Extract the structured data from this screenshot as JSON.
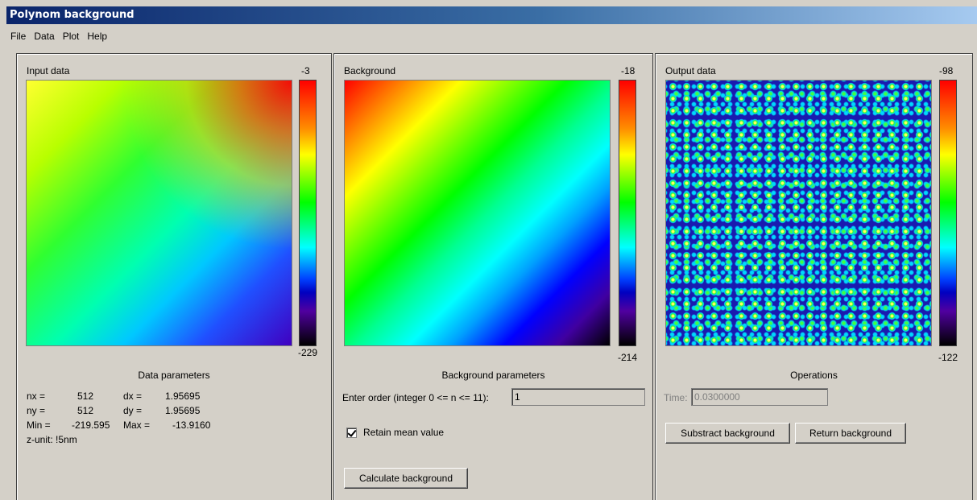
{
  "window": {
    "title": "Polynom background"
  },
  "menu": [
    "File",
    "Data",
    "Plot",
    "Help"
  ],
  "input_panel": {
    "title": "Input data",
    "scale_max": "-3",
    "scale_min": "-229",
    "params_title": "Data parameters",
    "nx_label": "nx =",
    "nx": "512",
    "dx_label": "dx =",
    "dx": "1.95695",
    "ny_label": "ny =",
    "ny": "512",
    "dy_label": "dy =",
    "dy": "1.95695",
    "min_label": "Min =",
    "min": "-219.595",
    "max_label": "Max =",
    "max": "-13.9160",
    "zunit": "z-unit: !5nm"
  },
  "background_panel": {
    "title": "Background",
    "scale_max": "-18",
    "scale_min": "-214",
    "params_title": "Background parameters",
    "order_label": "Enter order (integer 0 <= n <= 11):",
    "order_value": "1",
    "retain_label": "Retain mean value",
    "retain_checked": true,
    "calc_button": "Calculate background"
  },
  "output_panel": {
    "title": "Output data",
    "scale_max": "-98",
    "scale_min": "-122",
    "ops_title": "Operations",
    "time_label": "Time:",
    "time_value": "0.0300000",
    "subtract_button": "Substract background",
    "return_button": "Return background"
  },
  "colors": {
    "title_bar_start": "#0a246a",
    "title_bar_end": "#a6caf0",
    "window_face": "#d4d0c8"
  }
}
